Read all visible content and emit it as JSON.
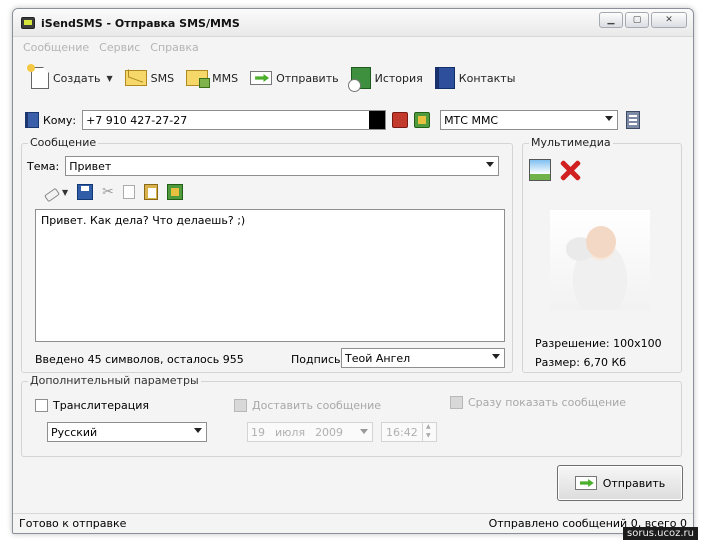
{
  "window": {
    "title": "iSendSMS - Отправка SMS/MMS"
  },
  "menu": [
    "Сообщение",
    "Сервис",
    "Справка"
  ],
  "toolbar": {
    "create": "Создать",
    "sms": "SMS",
    "mms": "MMS",
    "send": "Отправить",
    "history": "История",
    "contacts": "Контакты"
  },
  "recipient": {
    "label": "Кому:",
    "phone": "+7 910 427-27-27",
    "operator": "МТС ММС"
  },
  "message": {
    "group_title": "Сообщение",
    "subject_label": "Тема:",
    "subject": "Привет",
    "text": "Привет. Как дела? Что делаешь? ;)",
    "counter": "Введено 45 символов, осталось 955",
    "signature_label": "Подпись",
    "signature": "Теой Ангел"
  },
  "multimedia": {
    "group_title": "Мультимедиа",
    "resolution": "Разрешение: 100x100",
    "size": "Размер: 6,70 Кб"
  },
  "extra": {
    "group_title": "Дополнительный параметры",
    "translit": "Транслитерация",
    "deliver": "Доставить сообщение",
    "show": "Сразу показать сообщение",
    "language": "Русский",
    "day": "19",
    "month": "июля",
    "year": "2009",
    "time": "16:42"
  },
  "send_button": "Отправить",
  "status": {
    "left": "Готово к отправке",
    "right": "Отправлено сообщений 0, всего 0"
  },
  "watermark": "sorus.ucoz.ru"
}
